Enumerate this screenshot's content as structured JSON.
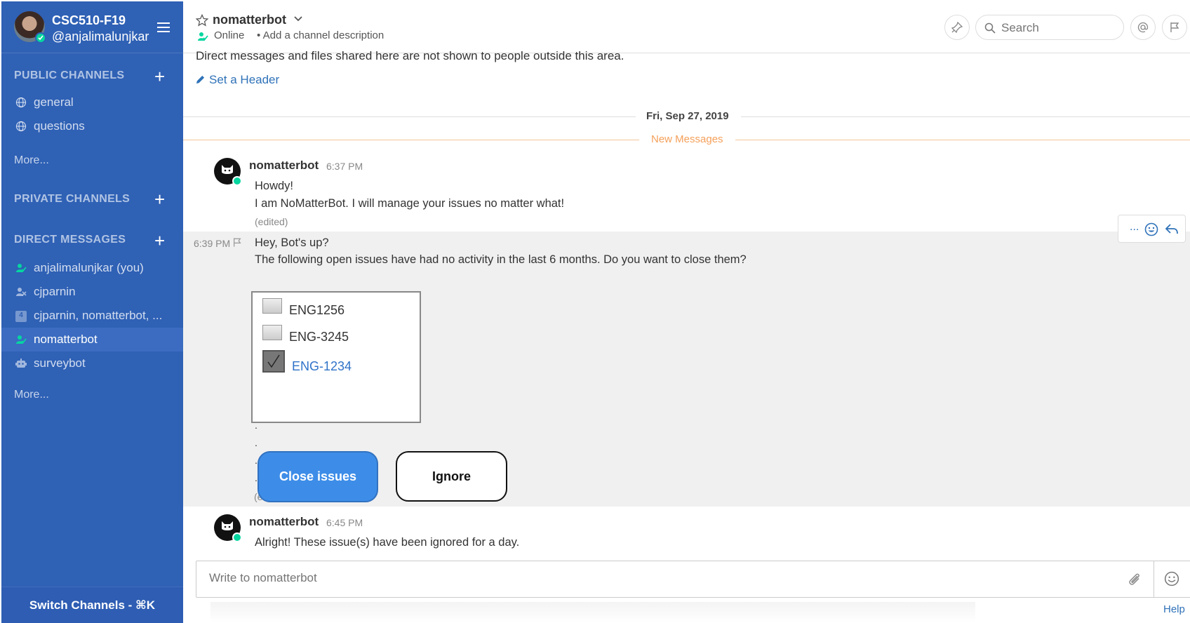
{
  "sidebar": {
    "team_name": "CSC510-F19",
    "username": "@anjalimalunjkar",
    "public_channels": {
      "title": "PUBLIC CHANNELS",
      "items": [
        {
          "label": "general",
          "icon": "globe-icon"
        },
        {
          "label": "questions",
          "icon": "globe-icon"
        }
      ],
      "more": "More..."
    },
    "private_channels": {
      "title": "PRIVATE CHANNELS"
    },
    "direct_messages": {
      "title": "DIRECT MESSAGES",
      "items": [
        {
          "label": "anjalimalunjkar (you)",
          "icon": "online-user-icon"
        },
        {
          "label": "cjparnin",
          "icon": "offline-user-icon"
        },
        {
          "label": "cjparnin, nomatterbot, ...",
          "icon": "group-count-icon",
          "badge": "4"
        },
        {
          "label": "nomatterbot",
          "icon": "online-user-icon",
          "active": true
        },
        {
          "label": "surveybot",
          "icon": "bot-icon"
        }
      ],
      "more": "More..."
    },
    "switch_channels": "Switch Channels - ⌘K"
  },
  "header": {
    "channel_name": "nomatterbot",
    "status": "Online",
    "description": "• Add a channel description",
    "search_placeholder": "Search"
  },
  "channel_intro": {
    "text": "Direct messages and files shared here are not shown to people outside this area.",
    "set_header": "Set a Header"
  },
  "date_separator": "Fri, Sep 27, 2019",
  "new_messages_label": "New Messages",
  "messages": [
    {
      "author": "nomatterbot",
      "time": "6:37 PM",
      "lines": [
        "Howdy!",
        "I am NoMatterBot. I will manage your issues no matter what!"
      ],
      "edited": "(edited)"
    },
    {
      "time": "6:39 PM",
      "lines": [
        "Hey, Bot's up?",
        "The following open issues have had no activity in the last 6 months. Do you want to close them?"
      ],
      "issues": [
        {
          "id": "ENG1256",
          "checked": false
        },
        {
          "id": "ENG-3245",
          "checked": false
        },
        {
          "id": "ENG-1234",
          "checked": true
        }
      ],
      "dots": [
        ".",
        ".",
        ".",
        "."
      ],
      "edited_fragment": "(e",
      "close_button": "Close issues",
      "ignore_button": "Ignore"
    },
    {
      "author": "nomatterbot",
      "time": "6:45 PM",
      "lines": [
        "Alright! These issue(s) have been ignored for a day."
      ]
    }
  ],
  "post_actions": {
    "more": "..."
  },
  "composer": {
    "placeholder": "Write to nomatterbot"
  },
  "help_link": "Help",
  "colors": {
    "sidebar_bg": "#2f61b5",
    "accent": "#2f72b8",
    "online": "#06d6a0",
    "new_messages": "#f5a05a",
    "close_button": "#3d8de8"
  }
}
